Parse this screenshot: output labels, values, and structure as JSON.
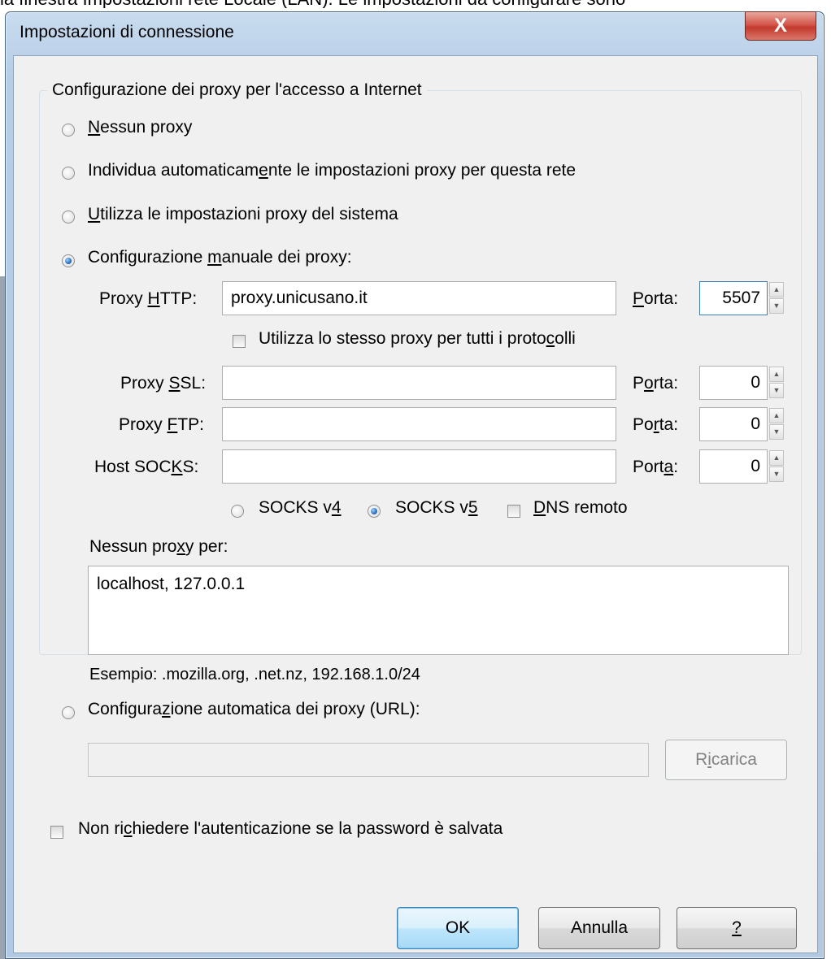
{
  "background_caption": "la finestra Impostazioni rete Locale (LAN). Le impostazioni da configurare sono",
  "window": {
    "title": "Impostazioni di connessione",
    "close_label": "X"
  },
  "group": {
    "legend": "Configurazione dei proxy per l'accesso a Internet",
    "options": {
      "no_proxy": {
        "pre": "",
        "key": "N",
        "post": "essun proxy",
        "checked": false
      },
      "auto_detect": {
        "pre": "Individua automaticam",
        "key": "e",
        "post": "nte le impostazioni proxy per questa rete",
        "checked": false
      },
      "system": {
        "pre": "",
        "key": "U",
        "post": "tilizza le impostazioni proxy del sistema",
        "checked": false
      },
      "manual": {
        "pre": "Configurazione ",
        "key": "m",
        "post": "anuale dei proxy:",
        "checked": true
      },
      "auto_url": {
        "pre": "Configura",
        "key": "z",
        "post": "ione automatica dei proxy (URL):",
        "checked": false
      }
    }
  },
  "manual": {
    "http": {
      "label_pre": "Proxy ",
      "label_key": "H",
      "label_post": "TTP:",
      "value": "proxy.unicusano.it",
      "port_label_pre": "",
      "port_label_key": "P",
      "port_label_post": "orta:",
      "port": "5507"
    },
    "same_proxy": {
      "pre": "Utilizza lo stesso proxy per tutti i proto",
      "key": "c",
      "post": "olli",
      "checked": false
    },
    "ssl": {
      "label_pre": "Proxy ",
      "label_key": "S",
      "label_post": "SL:",
      "value": "",
      "port_label_pre": "P",
      "port_label_key": "o",
      "port_label_post": "rta:",
      "port": "0"
    },
    "ftp": {
      "label_pre": "Proxy ",
      "label_key": "F",
      "label_post": "TP:",
      "value": "",
      "port_label_pre": "Po",
      "port_label_key": "r",
      "port_label_post": "ta:",
      "port": "0"
    },
    "socks": {
      "label_pre": "Host SOC",
      "label_key": "K",
      "label_post": "S:",
      "value": "",
      "port_label_pre": "Port",
      "port_label_key": "a",
      "port_label_post": ":",
      "port": "0"
    },
    "socks_v4": {
      "pre": "SOCKS v",
      "key": "4",
      "post": "",
      "checked": false
    },
    "socks_v5": {
      "pre": "SOCKS v",
      "key": "5",
      "post": "",
      "checked": true
    },
    "remote_dns": {
      "pre": "",
      "key": "D",
      "post": "NS remoto",
      "checked": false
    },
    "no_proxy_for": {
      "pre": "Nessun pro",
      "key": "x",
      "post": "y per:",
      "value": "localhost, 127.0.0.1"
    },
    "example": "Esempio: .mozilla.org, .net.nz, 192.168.1.0/24"
  },
  "auto_url": {
    "value": "",
    "reload_pre": "R",
    "reload_key": "i",
    "reload_post": "carica"
  },
  "no_auth": {
    "pre": "Non ri",
    "key": "c",
    "post": "hiedere l'autenticazione se la password è salvata",
    "checked": false
  },
  "buttons": {
    "ok": "OK",
    "cancel": "Annulla",
    "help": "?"
  }
}
